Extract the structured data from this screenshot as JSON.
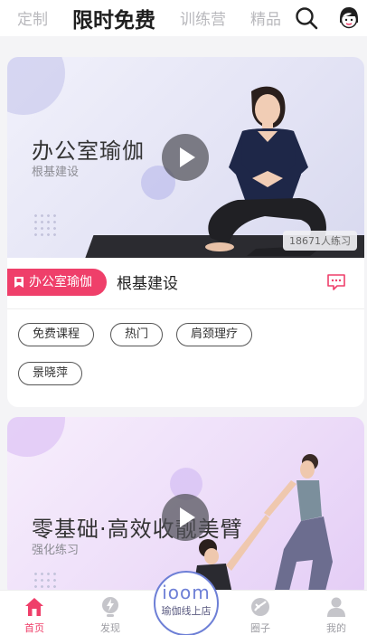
{
  "top_tabs": [
    {
      "label": "定制"
    },
    {
      "label": "限时免费"
    },
    {
      "label": "训练营"
    },
    {
      "label": "精品"
    }
  ],
  "cards": [
    {
      "hero_title": "办公室瑜伽",
      "hero_subtitle": "根基建设",
      "practice_count": "18671人练习",
      "category_tag": "办公室瑜伽",
      "title": "根基建设",
      "tags": [
        "免费课程",
        "热门",
        "肩颈理疗",
        "景晓萍"
      ]
    },
    {
      "hero_title": "零基础·高效收靓美臂",
      "hero_subtitle": "强化练习"
    }
  ],
  "bottom_nav": {
    "items": [
      {
        "label": "首页",
        "icon": "home-icon"
      },
      {
        "label": "发现",
        "icon": "discover-icon"
      },
      {
        "label": "圈子",
        "icon": "circle-icon"
      },
      {
        "label": "我的",
        "icon": "profile-icon"
      }
    ],
    "center": {
      "logo": "ioom",
      "label": "瑜伽线上店"
    }
  },
  "colors": {
    "accent": "#ef3f6a",
    "center_ring": "#6d7fd6"
  }
}
